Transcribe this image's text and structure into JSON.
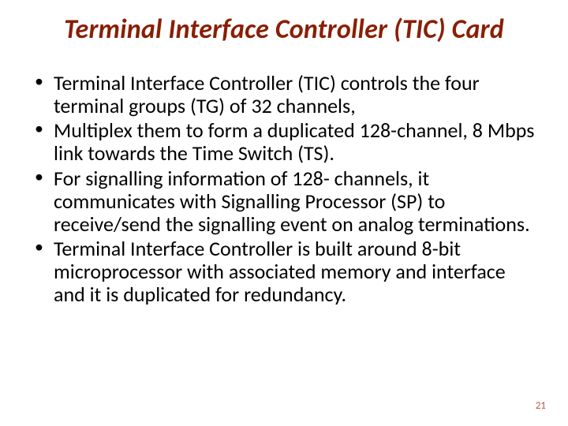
{
  "title": "Terminal Interface Controller (TIC) Card",
  "bullets": [
    "Terminal Interface Controller (TIC) controls the four terminal groups (TG) of 32 channels,",
    "Multiplex them to form a duplicated 128-channel, 8 Mbps link towards the Time Switch (TS).",
    "For signalling information of 128- channels, it communicates with Signalling Processor (SP) to receive/send the signalling event on analog terminations.",
    "Terminal Interface Controller is built around 8-bit microprocessor with associated memory and interface and it is duplicated for redundancy."
  ],
  "page_number": "21"
}
